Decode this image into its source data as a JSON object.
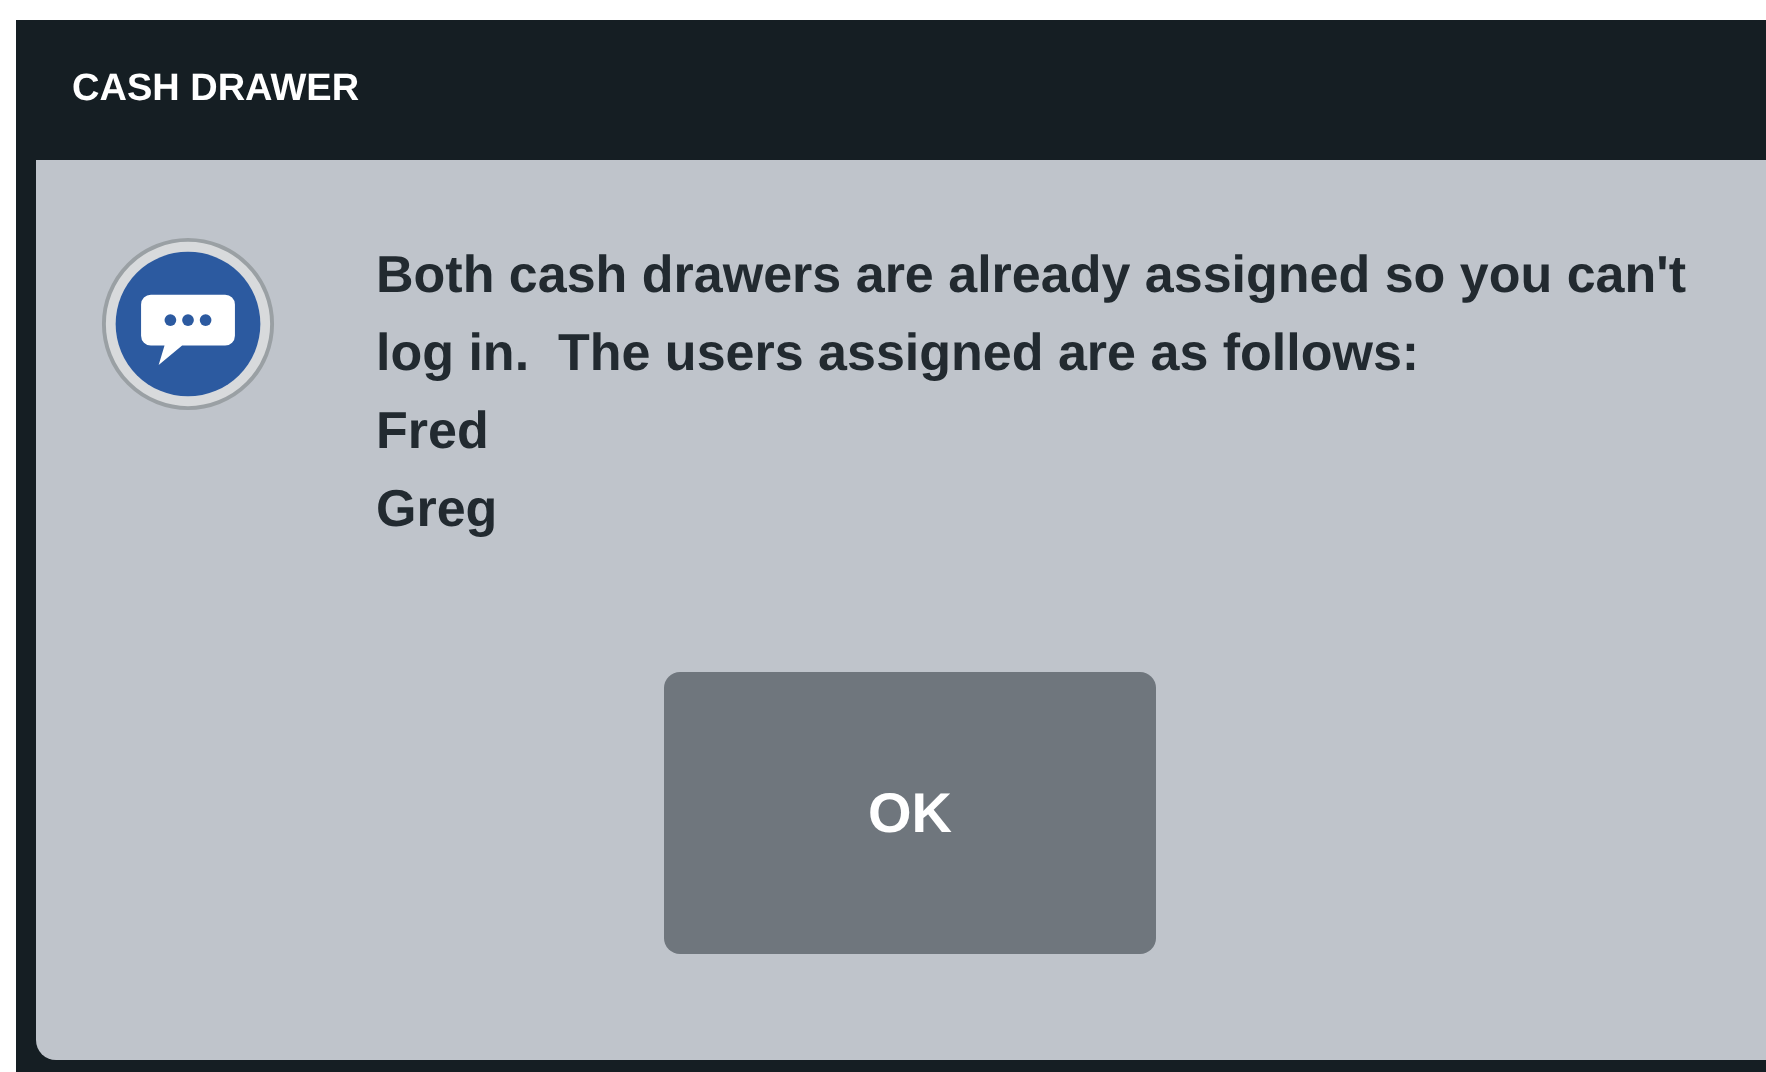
{
  "dialog": {
    "title": "CASH DRAWER",
    "message": "Both cash drawers are already assigned so you can't log in.  The users assigned are as follows:",
    "users": [
      "Fred",
      "Greg"
    ],
    "buttons": [
      "OK"
    ]
  }
}
